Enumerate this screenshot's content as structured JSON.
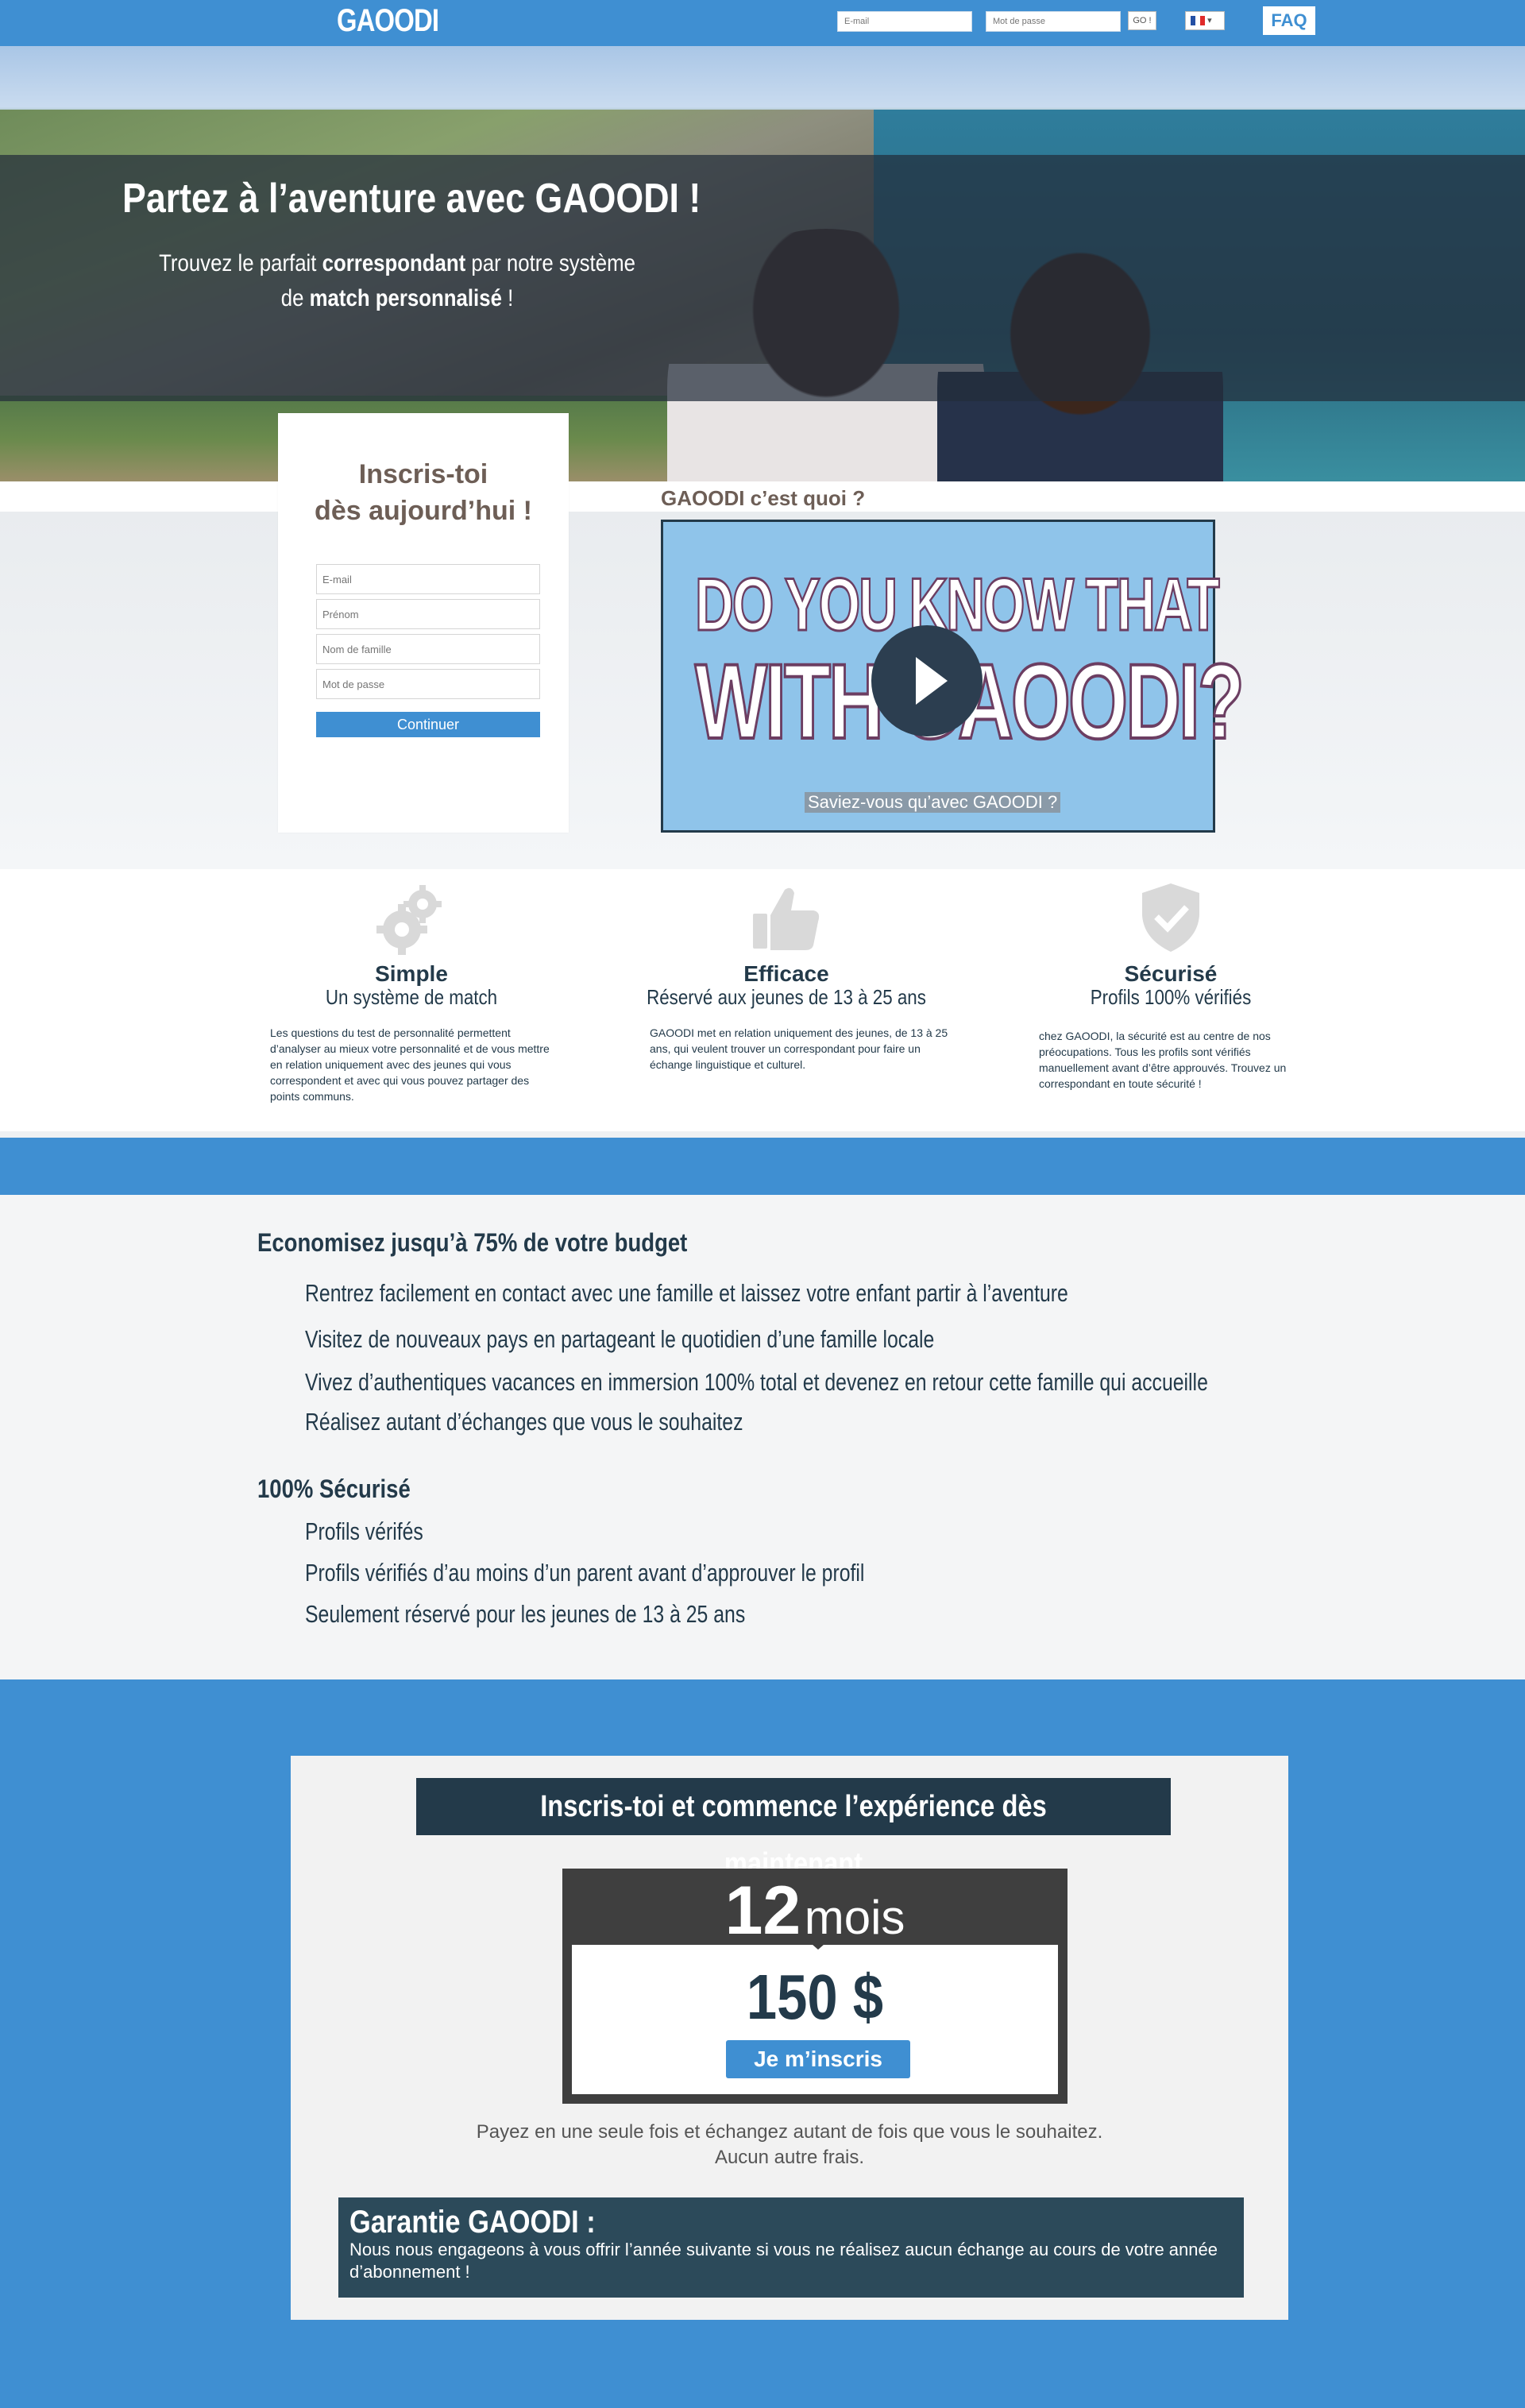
{
  "topbar": {
    "logo": "GAOODI",
    "email_placeholder": "E-mail",
    "password_placeholder": "Mot de passe",
    "go_label": "GO !",
    "language": "FR",
    "faq_label": "FAQ"
  },
  "hero": {
    "title": "Partez à l’aventure avec GAOODI !",
    "subtitle_pre": "Trouvez le parfait ",
    "subtitle_bold1": "correspondant",
    "subtitle_mid": " par notre système de ",
    "subtitle_bold2": "match personnalisé",
    "subtitle_post": " !"
  },
  "register": {
    "title_line1": "Inscris-toi",
    "title_line2": "dès aujourd’hui !",
    "email_placeholder": "E-mail",
    "firstname_placeholder": "Prénom",
    "lastname_placeholder": "Nom de famille",
    "password_placeholder": "Mot de passe",
    "continue_label": "Continuer"
  },
  "video": {
    "label": "GAOODI c’est quoi ?",
    "line1": "DO YOU KNOW THAT",
    "line2": "WITH GAOODI?",
    "caption": "Saviez-vous qu’avec GAOODI ?"
  },
  "features": [
    {
      "icon": "gears-icon",
      "title": "Simple",
      "subtitle": "Un système de match",
      "text": "Les questions du test de personnalité permettent d’analyser au mieux votre personnalité et de vous mettre en relation uniquement avec des jeunes qui vous correspondent et avec qui vous pouvez partager des points communs."
    },
    {
      "icon": "thumbs-up-icon",
      "title": "Efficace",
      "subtitle": "Réservé aux jeunes de 13 à 25 ans",
      "text": "GAOODI met en relation uniquement des jeunes, de 13 à 25 ans, qui veulent trouver un correspondant pour faire un échange linguistique et culturel."
    },
    {
      "icon": "shield-check-icon",
      "title": "Sécurisé",
      "subtitle": "Profils 100% vérifiés",
      "text": "chez GAOODI, la sécurité est au centre de nos préocupations. Tous les profils sont vérifiés manuellement avant d’être approuvés. Trouvez un correspondant en toute sécurité !"
    }
  ],
  "benefits": {
    "heading1": "Economisez jusqu’à 75% de votre budget",
    "items1": [
      "Rentrez facilement en contact avec une famille et laissez votre enfant partir à l’aventure",
      "Visitez de nouveaux pays en partageant le quotidien d’une famille locale",
      "Vivez d’authentiques vacances en immersion 100% total et devenez en retour cette famille qui accueille",
      "Réalisez autant d’échanges que vous le souhaitez"
    ],
    "heading2": "100% Sécurisé",
    "items2": [
      "Profils vérifés",
      "Profils vérifiés d’au moins d’un parent avant d’approuver le profil",
      "Seulement réservé pour les jeunes de 13 à 25 ans"
    ]
  },
  "cta": {
    "heading": "Inscris-toi  et commence l’expérience dès maintenant",
    "duration_number": "12",
    "duration_unit": "mois",
    "price": "150 $",
    "subscribe_label": "Je m’inscris",
    "note_line1": "Payez en une seule fois et échangez autant de fois que vous le souhaitez.",
    "note_line2": "Aucun autre frais.",
    "guarantee_title": "Garantie GAOODI :",
    "guarantee_text": "Nous nous engageons à vous offrir l’année suivante si vous ne réalisez aucun échange au cours de votre année d’abonnement !"
  },
  "colors": {
    "brand_blue": "#3f8fd2",
    "navy": "#233a4a",
    "brown": "#6d5e56"
  }
}
